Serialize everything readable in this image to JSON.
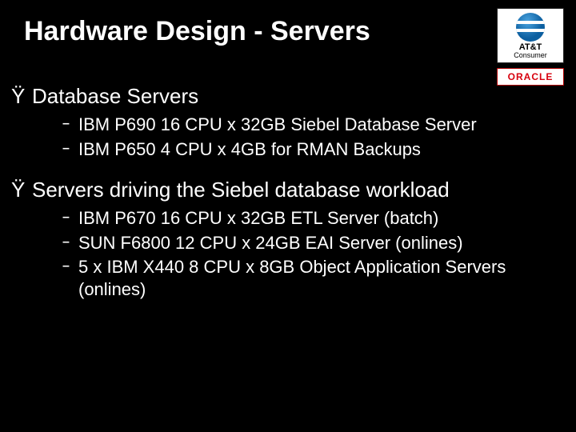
{
  "title": "Hardware Design - Servers",
  "logos": {
    "att_name": "AT&T",
    "att_sub": "Consumer",
    "oracle": "ORACLE"
  },
  "top_bullet_glyph": "Ÿ",
  "sub_bullet_glyph": "–",
  "sections": [
    {
      "heading": "Database Servers",
      "items": [
        "IBM P690 16 CPU x 32GB Siebel Database Server",
        "IBM P650 4 CPU x 4GB for RMAN Backups"
      ]
    },
    {
      "heading": "Servers driving the Siebel database workload",
      "items": [
        "IBM P670 16 CPU x 32GB ETL Server (batch)",
        "SUN F6800 12 CPU x 24GB EAI Server (onlines)",
        "5 x IBM X440 8 CPU x 8GB Object Application Servers (onlines)"
      ]
    }
  ]
}
